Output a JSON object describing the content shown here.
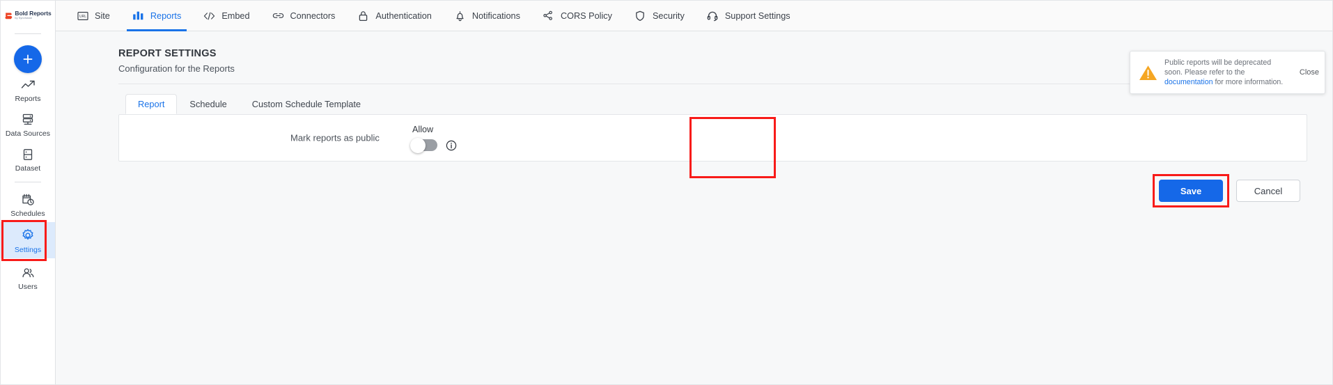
{
  "brand": {
    "name": "Bold Reports",
    "tagline": "by Syncfusion"
  },
  "sidebar": {
    "add_button": "add-button",
    "items": [
      {
        "label": "Reports",
        "icon": "trending-up-icon",
        "active": false
      },
      {
        "label": "Data Sources",
        "icon": "database-icon",
        "active": false
      },
      {
        "label": "Dataset",
        "icon": "dataset-icon",
        "active": false
      },
      {
        "label": "Schedules",
        "icon": "calendar-clock-icon",
        "active": false
      },
      {
        "label": "Settings",
        "icon": "gear-icon",
        "active": true
      },
      {
        "label": "Users",
        "icon": "users-icon",
        "active": false
      }
    ]
  },
  "topnav": {
    "items": [
      {
        "label": "Site",
        "icon": "url-icon",
        "active": false
      },
      {
        "label": "Reports",
        "icon": "bar-chart-icon",
        "active": true
      },
      {
        "label": "Embed",
        "icon": "code-icon",
        "active": false
      },
      {
        "label": "Connectors",
        "icon": "link-icon",
        "active": false
      },
      {
        "label": "Authentication",
        "icon": "lock-icon",
        "active": false
      },
      {
        "label": "Notifications",
        "icon": "bell-icon",
        "active": false
      },
      {
        "label": "CORS Policy",
        "icon": "share-nodes-icon",
        "active": false
      },
      {
        "label": "Security",
        "icon": "shield-icon",
        "active": false
      },
      {
        "label": "Support Settings",
        "icon": "headset-icon",
        "active": false
      }
    ]
  },
  "page": {
    "title": "REPORT SETTINGS",
    "subtitle": "Configuration for the Reports"
  },
  "tabs": [
    {
      "label": "Report",
      "active": true
    },
    {
      "label": "Schedule",
      "active": false
    },
    {
      "label": "Custom Schedule Template",
      "active": false
    }
  ],
  "setting": {
    "label": "Mark reports as public",
    "toggle_caption": "Allow",
    "toggle_state": "off",
    "info_icon": "info-icon"
  },
  "actions": {
    "save_label": "Save",
    "cancel_label": "Cancel"
  },
  "toast": {
    "text_before_link": "Public reports will be deprecated soon. Please refer to the ",
    "link_text": "documentation",
    "text_after_link": " for more information.",
    "close_label": "Close",
    "icon": "warning-triangle-icon"
  },
  "colors": {
    "accent": "#1568e8",
    "link": "#1a73e8",
    "highlight": "#f81b19",
    "warning": "#f5a623",
    "sidebar_active_bg": "#dceafc"
  }
}
